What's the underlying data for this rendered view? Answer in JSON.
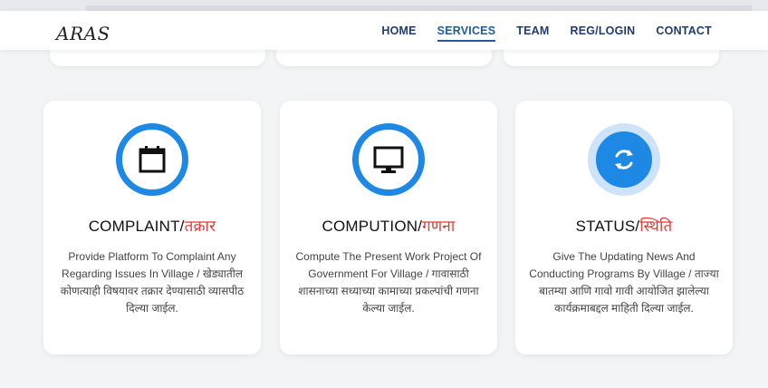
{
  "app": {
    "logo": "ARAS"
  },
  "nav": {
    "items": [
      "HOME",
      "SERVICES",
      "TEAM",
      "REG/LOGIN",
      "CONTACT"
    ],
    "active": "SERVICES"
  },
  "services": [
    {
      "title_en": "COMPLAINT/",
      "title_mr": "तक्रार",
      "icon": "calendar-icon",
      "description": "Provide Platform To Complaint Any Regarding Issues In Village / खेड्यातील कोणत्याही विषयावर तक्रार देण्यासाठी व्यासपीठ दिल्या जाईल."
    },
    {
      "title_en": "COMPUTION/",
      "title_mr": "गणना",
      "icon": "monitor-icon",
      "description": "Compute The Present Work Project Of Government For Village / गावासाठी शासनाच्या सध्याच्या कामाच्या प्रकल्पांची गणना केल्या जाईल."
    },
    {
      "title_en": "STATUS/",
      "title_mr": "स्थिति",
      "icon": "refresh-icon",
      "description": "Give The Updating News And Conducting Programs By Village / ताज्या बातम्या आणि गावो गावी आयोजित झालेल्या कार्यक्रमाबद्दल माहिती दिल्या जाईल."
    }
  ],
  "colors": {
    "accent": "#1e88e5",
    "marathi": "#e53935",
    "nav": "#1f3c6e"
  }
}
